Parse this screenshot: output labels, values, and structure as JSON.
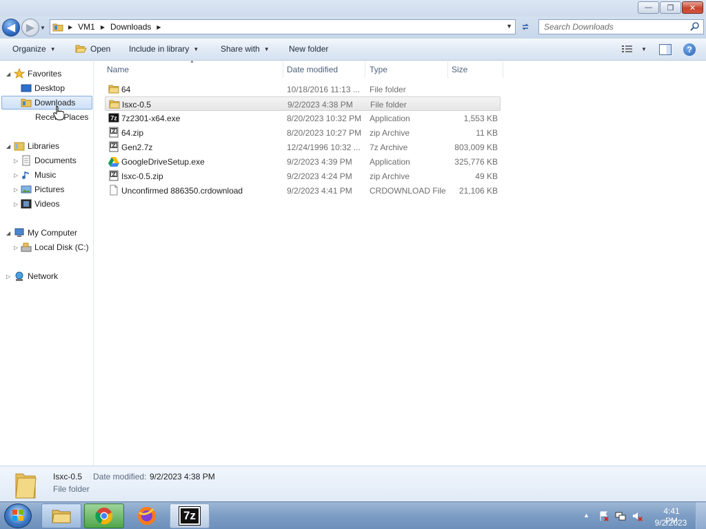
{
  "titlebar": {
    "min_glyph": "—",
    "max_glyph": "❐",
    "close_glyph": "✕"
  },
  "address": {
    "back_glyph": "◀",
    "fwd_glyph": "▶",
    "crumbs": [
      "VM1",
      "Downloads"
    ],
    "search_placeholder": "Search Downloads"
  },
  "toolbar": {
    "organize": "Organize",
    "open": "Open",
    "include_in_library": "Include in library",
    "share_with": "Share with",
    "new_folder": "New folder",
    "help_glyph": "?"
  },
  "navpane": {
    "favorites": "Favorites",
    "desktop": "Desktop",
    "downloads": "Downloads",
    "recent_places": "Recent Places",
    "libraries": "Libraries",
    "documents": "Documents",
    "music": "Music",
    "pictures": "Pictures",
    "videos": "Videos",
    "my_computer": "My Computer",
    "local_disk": "Local Disk (C:)",
    "network": "Network"
  },
  "columns": {
    "name": "Name",
    "date_modified": "Date modified",
    "type": "Type",
    "size": "Size"
  },
  "files": [
    {
      "name": "64",
      "date": "10/18/2016 11:13 ...",
      "type": "File folder",
      "size": "",
      "icon": "folder-icon"
    },
    {
      "name": "Isxc-0.5",
      "date": "9/2/2023 4:38 PM",
      "type": "File folder",
      "size": "",
      "icon": "folder-icon",
      "selected": true
    },
    {
      "name": "7z2301-x64.exe",
      "date": "8/20/2023 10:32 PM",
      "type": "Application",
      "size": "1,553 KB",
      "icon": "7zip-exe-icon"
    },
    {
      "name": "64.zip",
      "date": "8/20/2023 10:27 PM",
      "type": "zip Archive",
      "size": "11 KB",
      "icon": "archive-icon"
    },
    {
      "name": "Gen2.7z",
      "date": "12/24/1996 10:32 ...",
      "type": "7z Archive",
      "size": "803,009 KB",
      "icon": "archive-icon"
    },
    {
      "name": "GoogleDriveSetup.exe",
      "date": "9/2/2023 4:39 PM",
      "type": "Application",
      "size": "325,776 KB",
      "icon": "google-drive-icon"
    },
    {
      "name": "Isxc-0.5.zip",
      "date": "9/2/2023 4:24 PM",
      "type": "zip Archive",
      "size": "49 KB",
      "icon": "archive-icon"
    },
    {
      "name": "Unconfirmed 886350.crdownload",
      "date": "9/2/2023 4:41 PM",
      "type": "CRDOWNLOAD File",
      "size": "21,106 KB",
      "icon": "blank-file-icon"
    }
  ],
  "details": {
    "name": "Isxc-0.5",
    "date_label": "Date modified:",
    "date": "9/2/2023 4:38 PM",
    "type": "File folder"
  },
  "taskbar": {
    "sevenzip_label": "7z",
    "time": "4:41 PM",
    "date": "9/2/2023"
  }
}
